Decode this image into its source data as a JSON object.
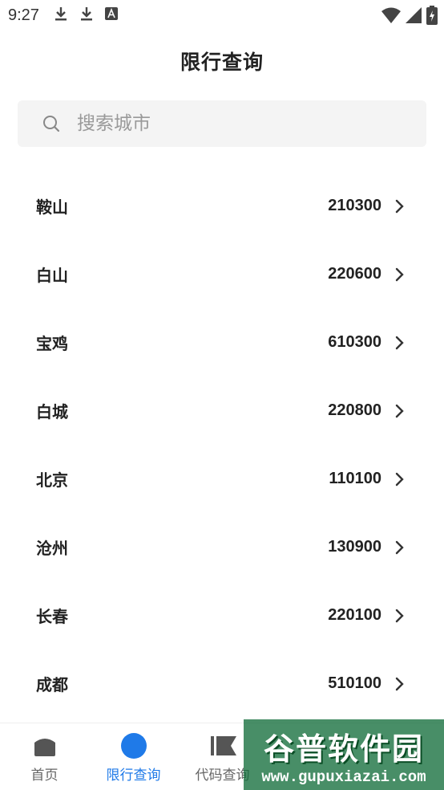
{
  "status_bar": {
    "time": "9:27",
    "icons": [
      "download-icon",
      "download-icon",
      "font-a-icon",
      "wifi-icon",
      "signal-icon",
      "battery-icon"
    ]
  },
  "header": {
    "title": "限行查询"
  },
  "search": {
    "placeholder": "搜索城市",
    "value": ""
  },
  "cities": [
    {
      "name": "鞍山",
      "code": "210300"
    },
    {
      "name": "白山",
      "code": "220600"
    },
    {
      "name": "宝鸡",
      "code": "610300"
    },
    {
      "name": "白城",
      "code": "220800"
    },
    {
      "name": "北京",
      "code": "110100"
    },
    {
      "name": "沧州",
      "code": "130900"
    },
    {
      "name": "长春",
      "code": "220100"
    },
    {
      "name": "成都",
      "code": "510100"
    }
  ],
  "bottom_nav": {
    "items": [
      {
        "label": "首页",
        "icon": "home-icon",
        "active": false
      },
      {
        "label": "限行查询",
        "icon": "search-dot-icon",
        "active": true
      },
      {
        "label": "代码查询",
        "icon": "flag-icon",
        "active": false
      }
    ]
  },
  "watermark": {
    "title": "谷普软件园",
    "url": "www.gupuxiazai.com"
  },
  "colors": {
    "accent": "#1f7ae8",
    "text": "#222222",
    "muted": "#999999",
    "search_bg": "#f4f4f4"
  }
}
